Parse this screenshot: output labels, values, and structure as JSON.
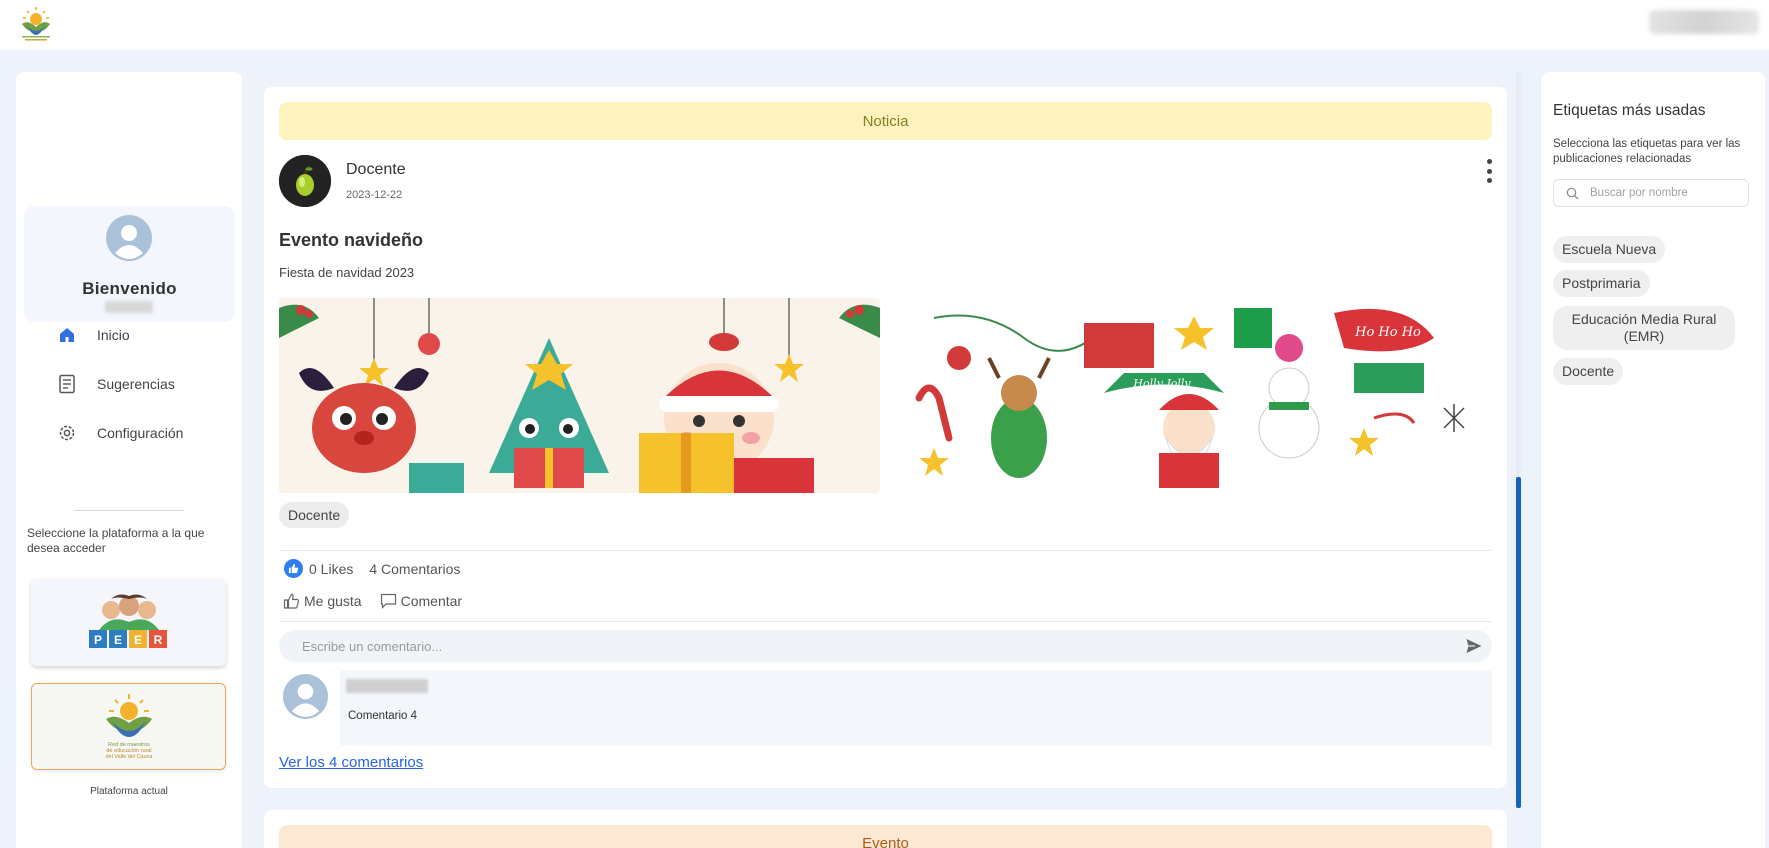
{
  "header": {
    "logo_icon": "rural-schools-network-logo-icon"
  },
  "sidebar": {
    "welcome_title": "Bienvenido",
    "nav": [
      {
        "label": "Inicio",
        "icon": "home-icon",
        "active": true
      },
      {
        "label": "Sugerencias",
        "icon": "document-icon"
      },
      {
        "label": "Configuración",
        "icon": "gear-icon"
      }
    ],
    "platform_prompt": "Seleccione la plataforma a la que desea acceder",
    "platforms": [
      {
        "name": "PEER",
        "letters": [
          "P",
          "E",
          "E",
          "R"
        ]
      },
      {
        "caption_lines": [
          "Red de maestros",
          "de educación rural",
          "del Valle del Cauca"
        ],
        "current": true
      }
    ],
    "current_platform_caption": "Plataforma actual"
  },
  "post": {
    "type_label": "Noticia",
    "author": "Docente",
    "date": "2023-12-22",
    "title": "Evento navideño",
    "description": "Fiesta de navidad 2023",
    "image_2_text": {
      "hohoho": "Ho Ho Ho",
      "holly": "Holly Jolly"
    },
    "tag": "Docente",
    "likes": "0 Likes",
    "comments_count": "4 Comentarios",
    "like_action": "Me gusta",
    "comment_action": "Comentar",
    "comment_placeholder": "Escribe un comentario...",
    "latest_comment": "Comentario 4",
    "see_comments": "Ver los 4 comentarios"
  },
  "post2": {
    "type_label": "Evento"
  },
  "right_panel": {
    "title": "Etiquetas más usadas",
    "subtitle": "Selecciona las etiquetas para ver las publicaciones relacionadas",
    "search_placeholder": "Buscar por nombre",
    "tags": [
      "Escuela Nueva",
      "Postprimaria",
      "Educación Media Rural (EMR)",
      "Docente"
    ]
  },
  "colors": {
    "noticia_bg": "#fcf3bf",
    "evento_bg": "#fde9d3",
    "accent_blue": "#1565c0",
    "link_blue": "#2563eb",
    "like_blue": "#2e7df3"
  }
}
